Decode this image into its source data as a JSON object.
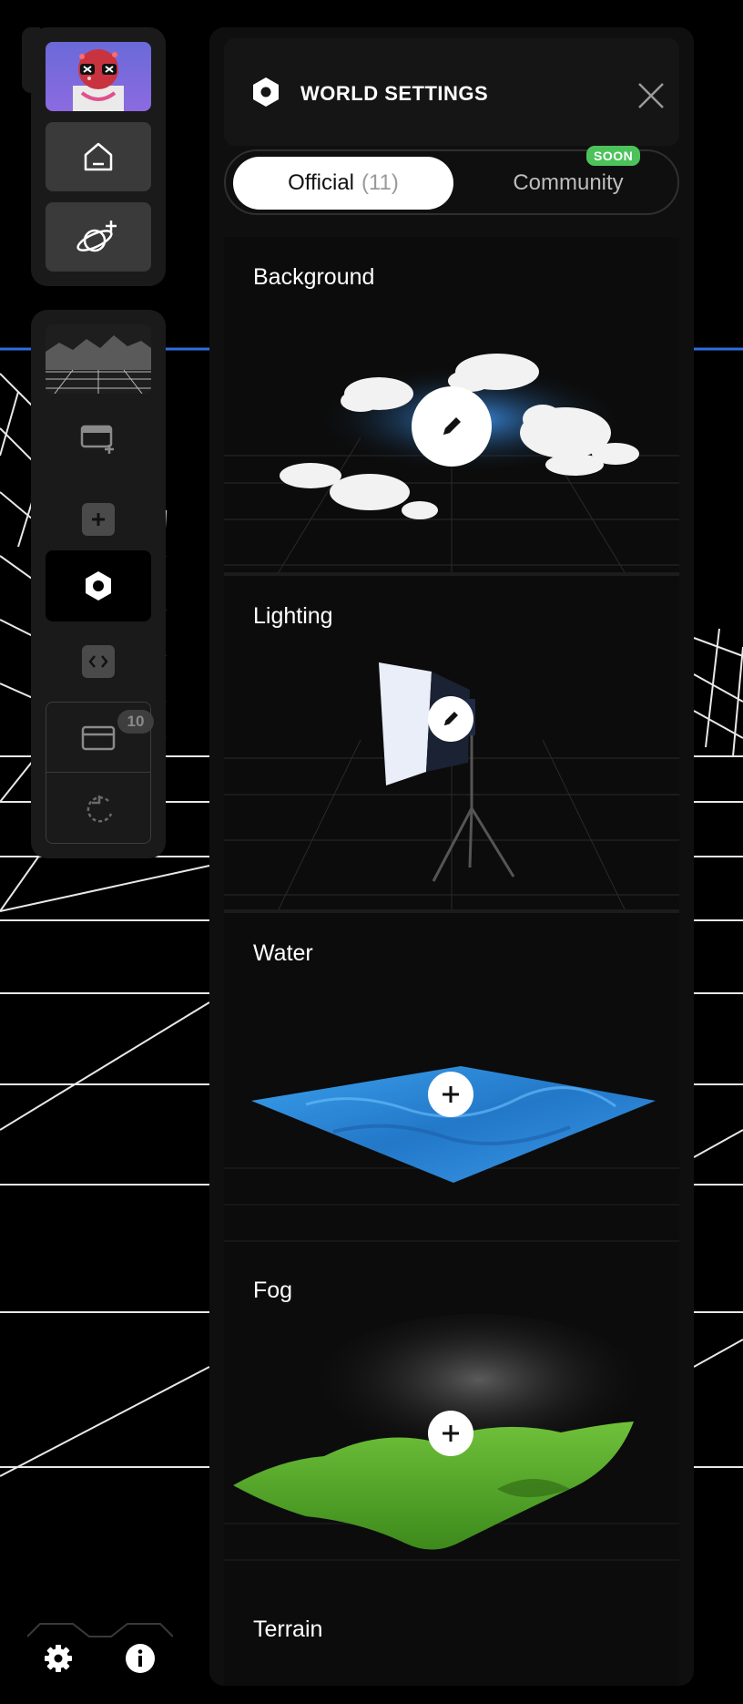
{
  "sidebar": {
    "avatar_label": "",
    "icons": [
      "avatar",
      "home-icon",
      "planet-add-icon",
      "world-thumbnail",
      "add-card-icon",
      "plus-icon",
      "hexagon-settings-icon",
      "code-icon",
      "card-icon",
      "rotate-icon"
    ],
    "cards_count": "10"
  },
  "footer": {
    "icons": [
      "gear-icon",
      "info-icon"
    ]
  },
  "panel": {
    "title": "WORLD SETTINGS",
    "tabs": {
      "official_label": "Official",
      "official_count": "(11)",
      "community_label": "Community",
      "community_badge": "SOON"
    },
    "sections": [
      {
        "title": "Background",
        "action": "edit"
      },
      {
        "title": "Lighting",
        "action": "edit"
      },
      {
        "title": "Water",
        "action": "add"
      },
      {
        "title": "Fog",
        "action": "add"
      },
      {
        "title": "Terrain",
        "action": "add"
      }
    ]
  },
  "colors": {
    "accent_blue": "#2f6fdf",
    "soon_green": "#4cc35a",
    "panel_bg": "#0f0f0f",
    "water_blue": "#2c8fe0",
    "fog_green": "#58a62a"
  }
}
